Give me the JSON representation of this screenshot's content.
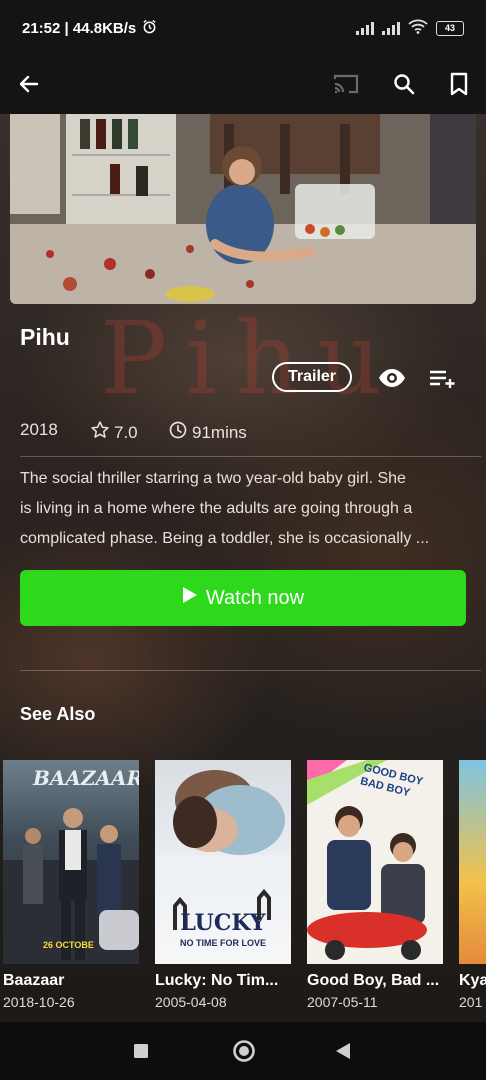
{
  "status_bar": {
    "time_speed": "21:52 | 44.8KB/s",
    "battery": "43"
  },
  "icons": {
    "back": "arrow-left-icon",
    "cast": "cast-icon",
    "search": "search-icon",
    "bookmark": "bookmark-icon",
    "alarm": "alarm-icon",
    "wifi": "wifi-icon",
    "eye": "eye-icon",
    "playlist_add": "playlist-add-icon",
    "star": "star-outline-icon",
    "clock": "clock-icon",
    "play": "play-icon"
  },
  "movie": {
    "title": "Pihu",
    "year": "2018",
    "rating": "7.0",
    "duration": "91mins",
    "description": "The social thriller starring a two year-old baby girl. She\nis living in a home where the adults are going through a\ncomplicated phase. Being a toddler, she is occasionally ...",
    "trailer_label": "Trailer",
    "watch_label": "Watch now"
  },
  "see_also": {
    "heading": "See Also",
    "items": [
      {
        "title": "Baazaar",
        "date": "2018-10-26",
        "poster_text": "BAAZAAR",
        "poster_sub": "26 OCTOBE"
      },
      {
        "title": "Lucky: No Tim...",
        "date": "2005-04-08",
        "poster_text": "LUCKY",
        "poster_sub": "NO TIME FOR LOVE"
      },
      {
        "title": "Good Boy, Bad ...",
        "date": "2007-05-11",
        "poster_text": "GOOD BOY BAD BOY",
        "poster_sub": ""
      },
      {
        "title": "Kya",
        "date": "201",
        "poster_text": "",
        "poster_sub": ""
      }
    ]
  },
  "colors": {
    "accent_green": "#2ed91c",
    "bar_bg": "#141414"
  }
}
